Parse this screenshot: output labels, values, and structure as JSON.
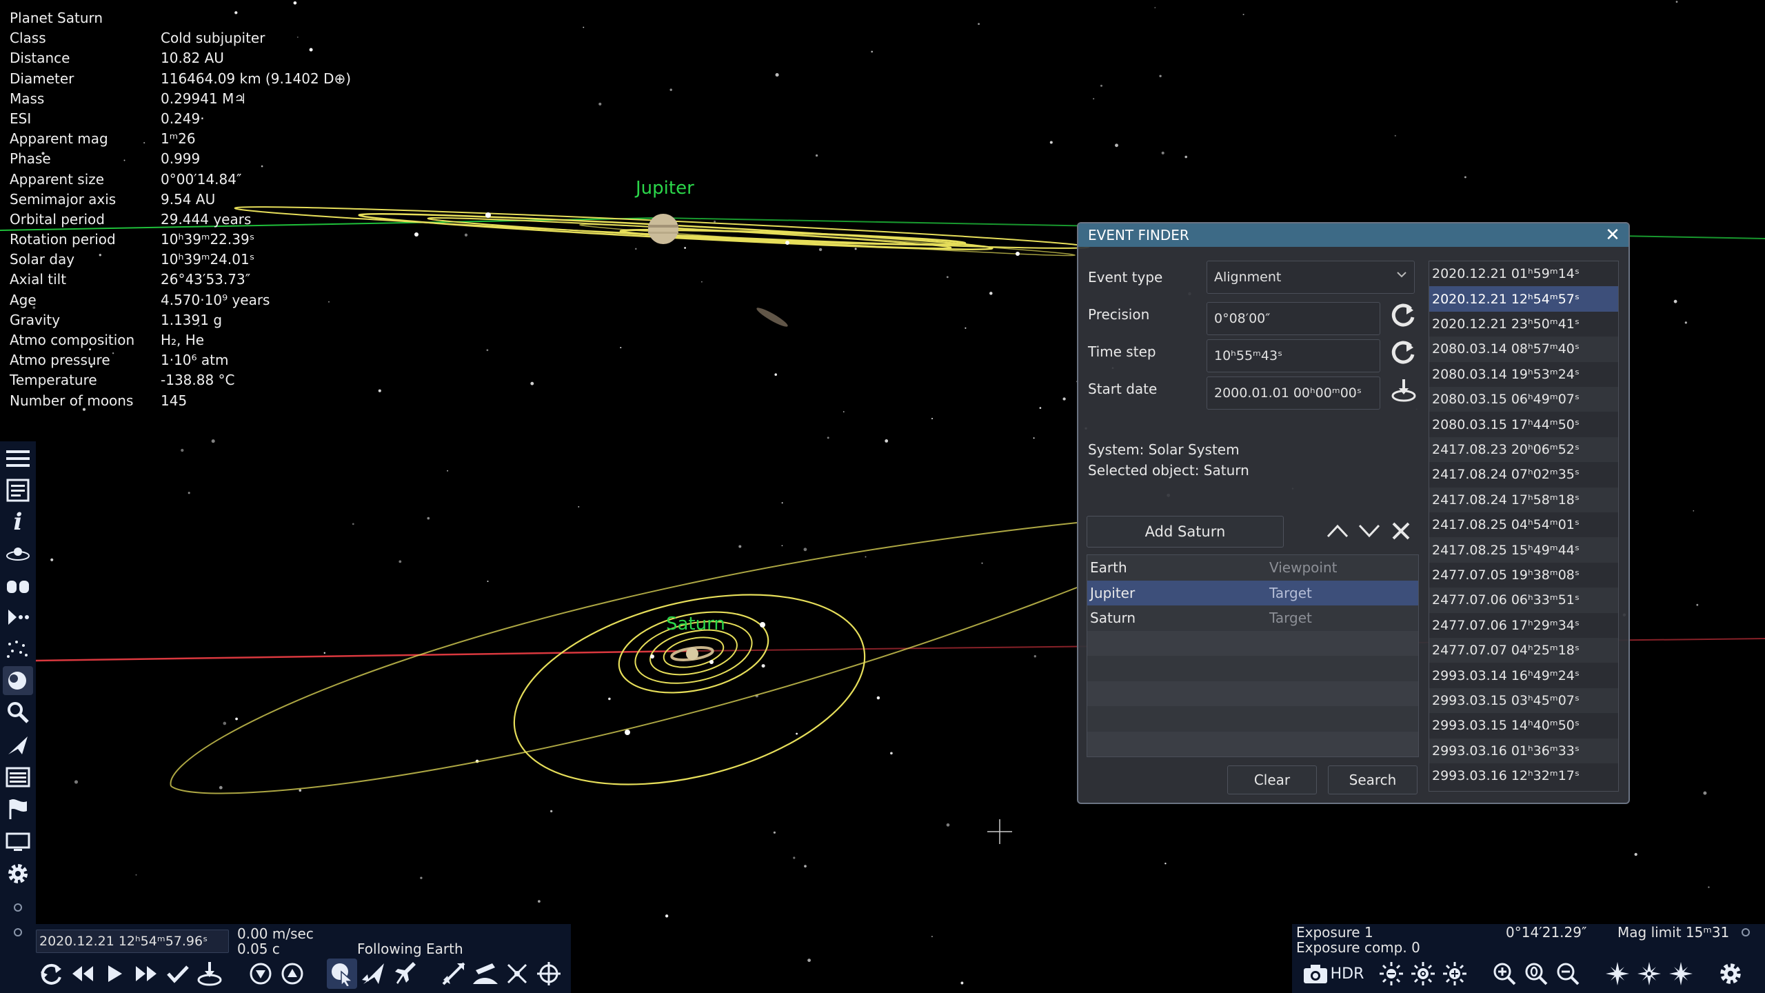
{
  "info": {
    "title": "Planet  Saturn",
    "rows": [
      {
        "k": "Class",
        "v": "Cold subjupiter"
      },
      {
        "k": "Distance",
        "v": "10.82 AU"
      },
      {
        "k": "Diameter",
        "v": "116464.09 km (9.1402 D⊕)"
      },
      {
        "k": "Mass",
        "v": "0.29941 M♃"
      },
      {
        "k": "ESI",
        "v": "0.249·"
      },
      {
        "k": "Apparent mag",
        "v": "1ᵐ26"
      },
      {
        "k": "Phase",
        "v": "0.999"
      },
      {
        "k": "Apparent size",
        "v": "0°00′14.84″"
      },
      {
        "k": "Semimajor axis",
        "v": "9.54 AU"
      },
      {
        "k": "Orbital period",
        "v": "29.444 years"
      },
      {
        "k": "Rotation period",
        "v": "10ʰ39ᵐ22.39ˢ"
      },
      {
        "k": "Solar day",
        "v": "10ʰ39ᵐ24.01ˢ"
      },
      {
        "k": "Axial tilt",
        "v": "26°43′53.73″"
      },
      {
        "k": "Age",
        "v": "4.570·10⁹ years"
      },
      {
        "k": "Gravity",
        "v": "1.1391 g"
      },
      {
        "k": "Atmo composition",
        "v": "H₂, He"
      },
      {
        "k": "Atmo pressure",
        "v": "1·10⁶ atm"
      },
      {
        "k": "Temperature",
        "v": "-138.88 °C"
      },
      {
        "k": "Number of moons",
        "v": "145"
      }
    ]
  },
  "labels": {
    "jupiter": "Jupiter",
    "saturn": "Saturn"
  },
  "event_finder": {
    "title": "EVENT FINDER",
    "close_icon": "close-icon",
    "event_type_label": "Event type",
    "event_type_value": "Alignment",
    "precision_label": "Precision",
    "precision_value": "0°08′00″",
    "time_step_label": "Time step",
    "time_step_value": "10ʰ55ᵐ43ˢ",
    "start_date_label": "Start date",
    "start_date_value": "2000.01.01 00ʰ00ᵐ00ˢ",
    "system_text": "System: Solar System",
    "selected_text": "Selected object: Saturn",
    "add_button": "Add Saturn",
    "objects": [
      {
        "name": "Earth",
        "role": "Viewpoint",
        "selected": false
      },
      {
        "name": "Jupiter",
        "role": "Target",
        "selected": true
      },
      {
        "name": "Saturn",
        "role": "Target",
        "selected": false
      }
    ],
    "clear_button": "Clear",
    "search_button": "Search",
    "results": [
      "2020.12.21 01ʰ59ᵐ14ˢ",
      "2020.12.21 12ʰ54ᵐ57ˢ",
      "2020.12.21 23ʰ50ᵐ41ˢ",
      "2080.03.14 08ʰ57ᵐ40ˢ",
      "2080.03.14 19ʰ53ᵐ24ˢ",
      "2080.03.15 06ʰ49ᵐ07ˢ",
      "2080.03.15 17ʰ44ᵐ50ˢ",
      "2417.08.23 20ʰ06ᵐ52ˢ",
      "2417.08.24 07ʰ02ᵐ35ˢ",
      "2417.08.24 17ʰ58ᵐ18ˢ",
      "2417.08.25 04ʰ54ᵐ01ˢ",
      "2417.08.25 15ʰ49ᵐ44ˢ",
      "2477.07.05 19ʰ38ᵐ08ˢ",
      "2477.07.06 06ʰ33ᵐ51ˢ",
      "2477.07.06 17ʰ29ᵐ34ˢ",
      "2477.07.07 04ʰ25ᵐ18ˢ",
      "2993.03.14 16ʰ49ᵐ24ˢ",
      "2993.03.15 03ʰ45ᵐ07ˢ",
      "2993.03.15 14ʰ40ᵐ50ˢ",
      "2993.03.16 01ʰ36ᵐ33ˢ",
      "2993.03.16 12ʰ32ᵐ17ˢ"
    ],
    "selected_result": 1
  },
  "bottom_left": {
    "date": "2020.12.21 12ʰ54ᵐ57.96ˢ",
    "speed": "0.00 m/sec",
    "speed_c": "0.05 c",
    "status": "Following Earth"
  },
  "bottom_right": {
    "exposure": "Exposure 1",
    "exposure_comp": "Exposure comp. 0",
    "fov": "0°14′21.29″",
    "mag_limit": "Mag limit 15ᵐ31",
    "hdr": "HDR"
  },
  "colors": {
    "toolbar_bg": "#0b1428",
    "dialog_header": "#3d6a86",
    "selection": "#3d4f7a",
    "planet_label": "#2bd64a",
    "orbit": "#e8e060"
  }
}
